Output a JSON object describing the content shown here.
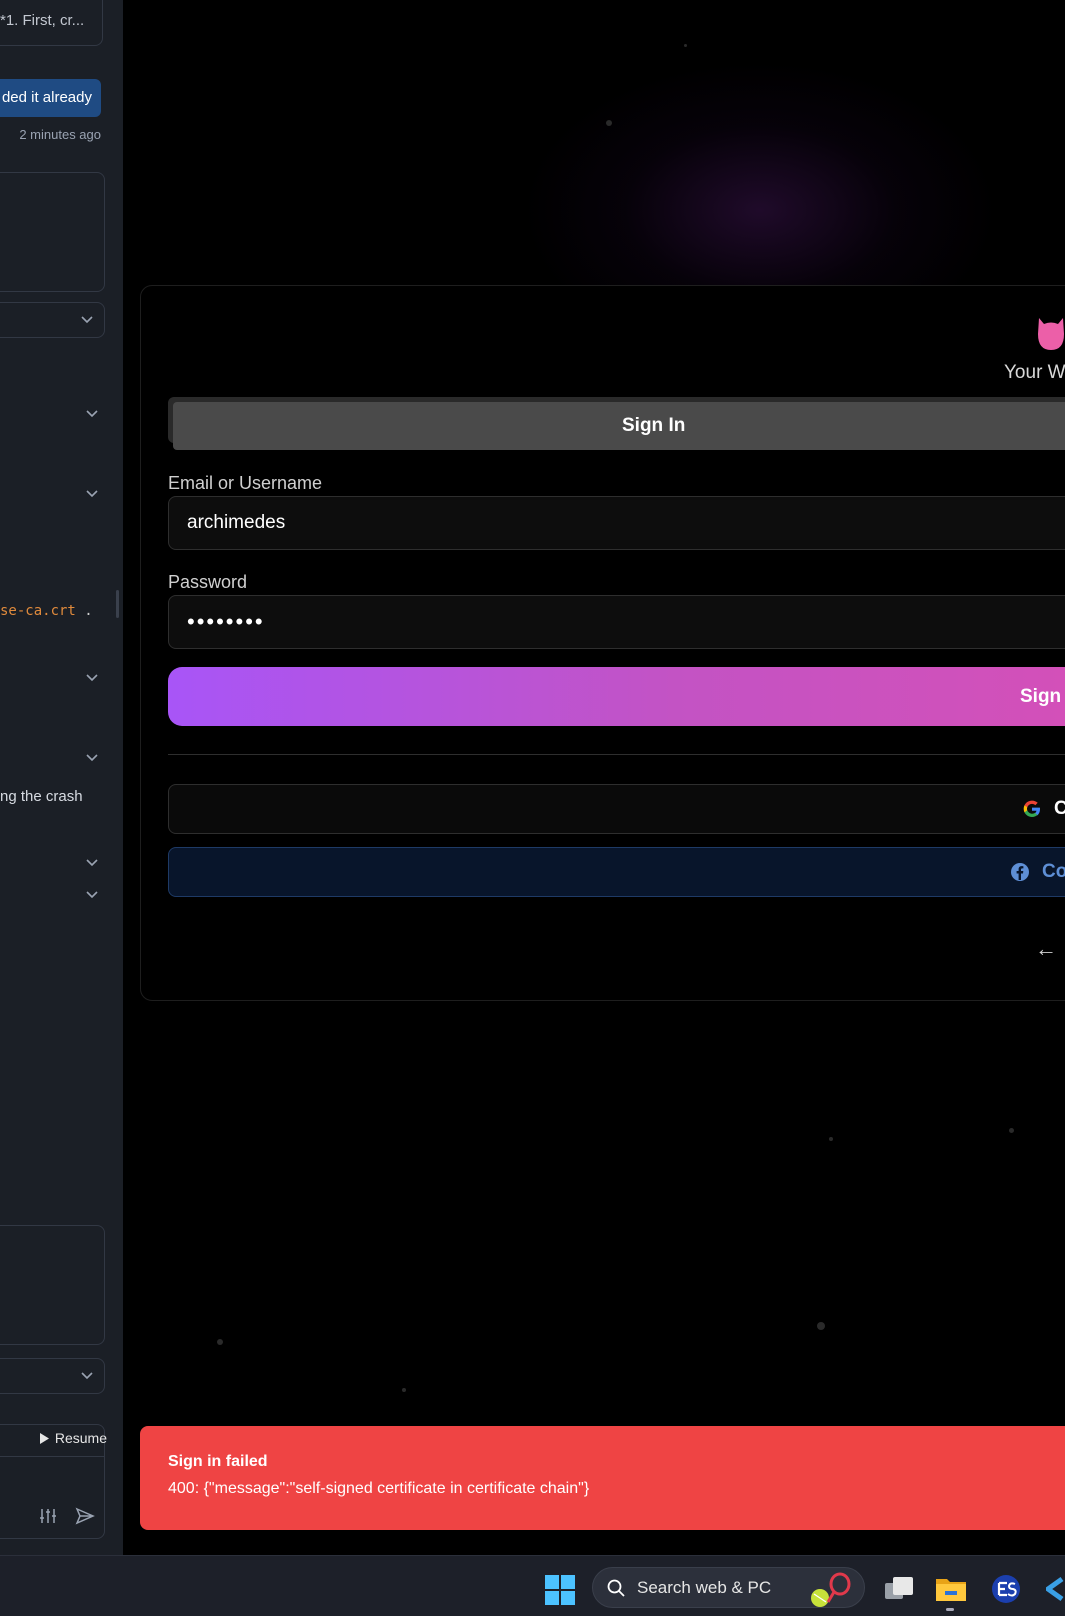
{
  "left_panel": {
    "snippet": "*1. First, cr...",
    "chip_text": "ded it already",
    "timestamp": "2 minutes ago",
    "code_filename": "se-ca.crt",
    "code_dot": ".",
    "crash_text": "ng the crash",
    "resume_label": "Resume"
  },
  "auth": {
    "tagline": "Your W",
    "tab_signin": "Sign In",
    "email_label": "Email or Username",
    "email_value": "archimedes",
    "password_label": "Password",
    "password_value": "••••••••",
    "submit_label": "Sign",
    "google_label": "C",
    "facebook_label": "Co",
    "back_label": "← "
  },
  "toast": {
    "title": "Sign in failed",
    "message": "400: {\"message\":\"self-signed certificate in certificate chain\"}"
  },
  "taskbar": {
    "search_text": "Search web & PC"
  },
  "colors": {
    "toast_bg": "#ef4444",
    "accent_purple": "#a855f7",
    "accent_pink": "#d450b8",
    "chip_blue": "#1f4b83",
    "logo_pink": "#ec5fa8"
  }
}
